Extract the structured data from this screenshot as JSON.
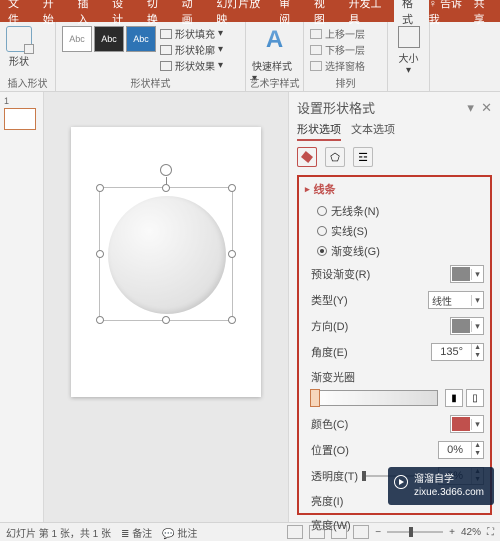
{
  "tabs": {
    "file": "文件",
    "home": "开始",
    "insert": "插入",
    "design": "设计",
    "transitions": "切换",
    "animations": "动画",
    "slideshow": "幻灯片放映",
    "review": "审阅",
    "view": "视图",
    "devtools": "开发工具",
    "format": "格式",
    "tellme": "告诉我",
    "share": "共享"
  },
  "ribbon": {
    "insert_shape": {
      "label": "插入形状",
      "button": "形状"
    },
    "shape_style": {
      "label": "形状样式",
      "swatch_text": "Abc",
      "fill": "形状填充",
      "outline": "形状轮廓",
      "effects": "形状效果"
    },
    "wordart": {
      "label": "艺术字样式",
      "quick": "快速样式"
    },
    "arrange": {
      "label": "排列",
      "bring_forward": "上移一层",
      "send_backward": "下移一层",
      "selection_pane": "选择窗格"
    },
    "size": {
      "label": "大小",
      "button": "大小"
    }
  },
  "thumb": {
    "num": "1"
  },
  "pane": {
    "title": "设置形状格式",
    "tab_shape": "形状选项",
    "tab_text": "文本选项",
    "section_line": "线条",
    "no_line": "无线条(N)",
    "solid": "实线(S)",
    "gradient": "渐变线(G)",
    "preset": "预设渐变(R)",
    "type": "类型(Y)",
    "type_value": "线性",
    "direction": "方向(D)",
    "angle": "角度(E)",
    "angle_value": "135°",
    "grad_stops": "渐变光圈",
    "color": "颜色(C)",
    "position": "位置(O)",
    "position_value": "0%",
    "transparency": "透明度(T)",
    "transparency_value": "0%",
    "brightness": "亮度(I)",
    "width": "宽度(W)"
  },
  "status": {
    "slide": "幻灯片 第 1 张，共 1 张",
    "notes": "备注",
    "comments": "批注",
    "zoom": "42%"
  },
  "watermark": {
    "brand": "溜溜自学",
    "url": "zixue.3d66.com"
  }
}
